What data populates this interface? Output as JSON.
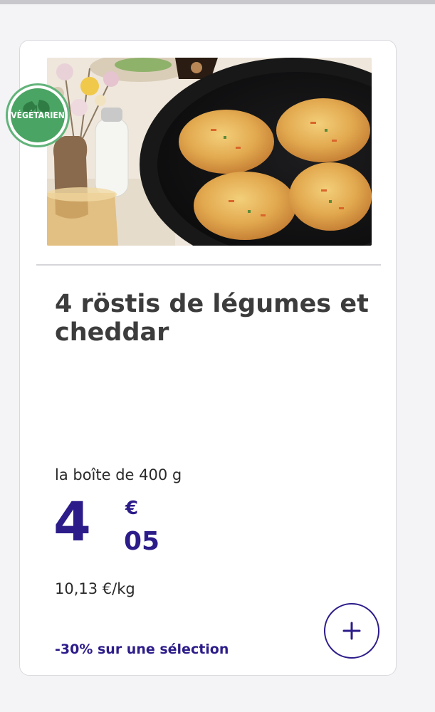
{
  "badge": {
    "label": "VÉGÉTARIEN",
    "icon": "leaf-icon"
  },
  "product": {
    "name": "4 röstis de légumes et cheddar",
    "unit": "la boîte de 400 g",
    "price": {
      "integer": "4",
      "currency": "€",
      "cents": "05"
    },
    "price_per_kg": "10,13 €/kg",
    "promo": "-30% sur une sélection"
  },
  "actions": {
    "add_icon": "plus-icon"
  },
  "colors": {
    "brand": "#2c1c8a",
    "badge_green": "#4aa463",
    "title_text": "#3c3c3c"
  }
}
